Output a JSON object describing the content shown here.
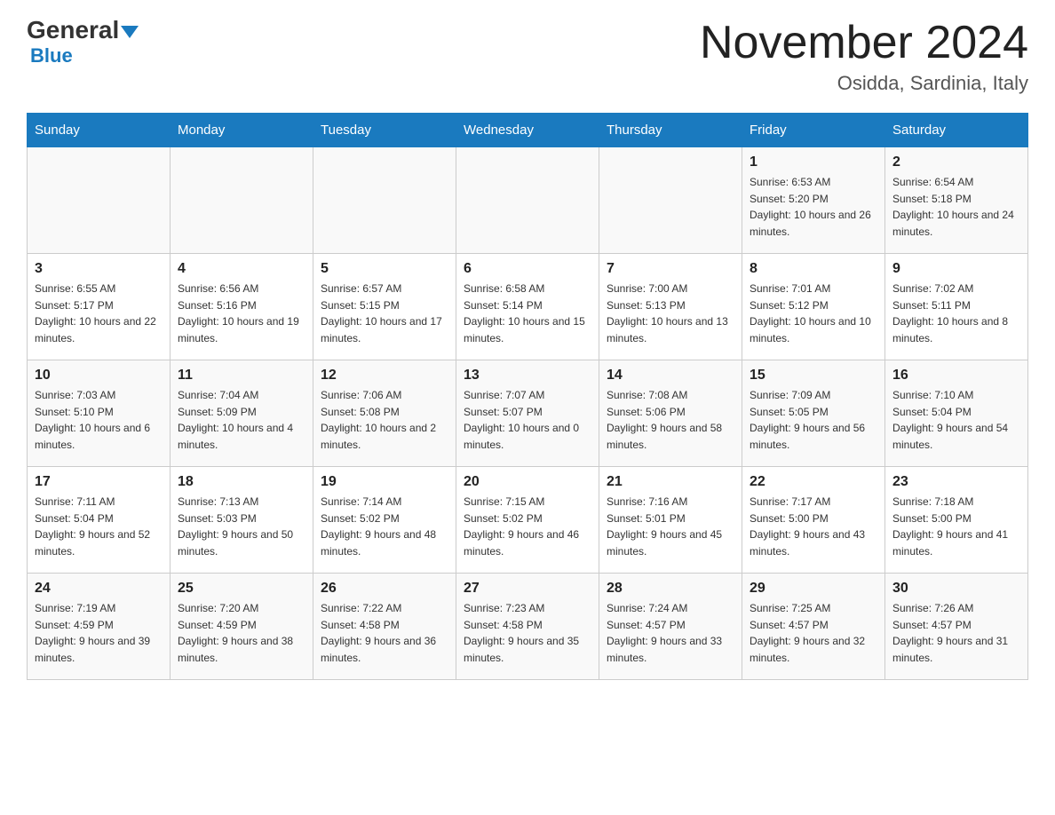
{
  "header": {
    "logo_general": "General",
    "logo_blue": "Blue",
    "month_title": "November 2024",
    "location": "Osidda, Sardinia, Italy"
  },
  "weekdays": [
    "Sunday",
    "Monday",
    "Tuesday",
    "Wednesday",
    "Thursday",
    "Friday",
    "Saturday"
  ],
  "weeks": [
    [
      {
        "day": "",
        "info": ""
      },
      {
        "day": "",
        "info": ""
      },
      {
        "day": "",
        "info": ""
      },
      {
        "day": "",
        "info": ""
      },
      {
        "day": "",
        "info": ""
      },
      {
        "day": "1",
        "info": "Sunrise: 6:53 AM\nSunset: 5:20 PM\nDaylight: 10 hours and 26 minutes."
      },
      {
        "day": "2",
        "info": "Sunrise: 6:54 AM\nSunset: 5:18 PM\nDaylight: 10 hours and 24 minutes."
      }
    ],
    [
      {
        "day": "3",
        "info": "Sunrise: 6:55 AM\nSunset: 5:17 PM\nDaylight: 10 hours and 22 minutes."
      },
      {
        "day": "4",
        "info": "Sunrise: 6:56 AM\nSunset: 5:16 PM\nDaylight: 10 hours and 19 minutes."
      },
      {
        "day": "5",
        "info": "Sunrise: 6:57 AM\nSunset: 5:15 PM\nDaylight: 10 hours and 17 minutes."
      },
      {
        "day": "6",
        "info": "Sunrise: 6:58 AM\nSunset: 5:14 PM\nDaylight: 10 hours and 15 minutes."
      },
      {
        "day": "7",
        "info": "Sunrise: 7:00 AM\nSunset: 5:13 PM\nDaylight: 10 hours and 13 minutes."
      },
      {
        "day": "8",
        "info": "Sunrise: 7:01 AM\nSunset: 5:12 PM\nDaylight: 10 hours and 10 minutes."
      },
      {
        "day": "9",
        "info": "Sunrise: 7:02 AM\nSunset: 5:11 PM\nDaylight: 10 hours and 8 minutes."
      }
    ],
    [
      {
        "day": "10",
        "info": "Sunrise: 7:03 AM\nSunset: 5:10 PM\nDaylight: 10 hours and 6 minutes."
      },
      {
        "day": "11",
        "info": "Sunrise: 7:04 AM\nSunset: 5:09 PM\nDaylight: 10 hours and 4 minutes."
      },
      {
        "day": "12",
        "info": "Sunrise: 7:06 AM\nSunset: 5:08 PM\nDaylight: 10 hours and 2 minutes."
      },
      {
        "day": "13",
        "info": "Sunrise: 7:07 AM\nSunset: 5:07 PM\nDaylight: 10 hours and 0 minutes."
      },
      {
        "day": "14",
        "info": "Sunrise: 7:08 AM\nSunset: 5:06 PM\nDaylight: 9 hours and 58 minutes."
      },
      {
        "day": "15",
        "info": "Sunrise: 7:09 AM\nSunset: 5:05 PM\nDaylight: 9 hours and 56 minutes."
      },
      {
        "day": "16",
        "info": "Sunrise: 7:10 AM\nSunset: 5:04 PM\nDaylight: 9 hours and 54 minutes."
      }
    ],
    [
      {
        "day": "17",
        "info": "Sunrise: 7:11 AM\nSunset: 5:04 PM\nDaylight: 9 hours and 52 minutes."
      },
      {
        "day": "18",
        "info": "Sunrise: 7:13 AM\nSunset: 5:03 PM\nDaylight: 9 hours and 50 minutes."
      },
      {
        "day": "19",
        "info": "Sunrise: 7:14 AM\nSunset: 5:02 PM\nDaylight: 9 hours and 48 minutes."
      },
      {
        "day": "20",
        "info": "Sunrise: 7:15 AM\nSunset: 5:02 PM\nDaylight: 9 hours and 46 minutes."
      },
      {
        "day": "21",
        "info": "Sunrise: 7:16 AM\nSunset: 5:01 PM\nDaylight: 9 hours and 45 minutes."
      },
      {
        "day": "22",
        "info": "Sunrise: 7:17 AM\nSunset: 5:00 PM\nDaylight: 9 hours and 43 minutes."
      },
      {
        "day": "23",
        "info": "Sunrise: 7:18 AM\nSunset: 5:00 PM\nDaylight: 9 hours and 41 minutes."
      }
    ],
    [
      {
        "day": "24",
        "info": "Sunrise: 7:19 AM\nSunset: 4:59 PM\nDaylight: 9 hours and 39 minutes."
      },
      {
        "day": "25",
        "info": "Sunrise: 7:20 AM\nSunset: 4:59 PM\nDaylight: 9 hours and 38 minutes."
      },
      {
        "day": "26",
        "info": "Sunrise: 7:22 AM\nSunset: 4:58 PM\nDaylight: 9 hours and 36 minutes."
      },
      {
        "day": "27",
        "info": "Sunrise: 7:23 AM\nSunset: 4:58 PM\nDaylight: 9 hours and 35 minutes."
      },
      {
        "day": "28",
        "info": "Sunrise: 7:24 AM\nSunset: 4:57 PM\nDaylight: 9 hours and 33 minutes."
      },
      {
        "day": "29",
        "info": "Sunrise: 7:25 AM\nSunset: 4:57 PM\nDaylight: 9 hours and 32 minutes."
      },
      {
        "day": "30",
        "info": "Sunrise: 7:26 AM\nSunset: 4:57 PM\nDaylight: 9 hours and 31 minutes."
      }
    ]
  ]
}
